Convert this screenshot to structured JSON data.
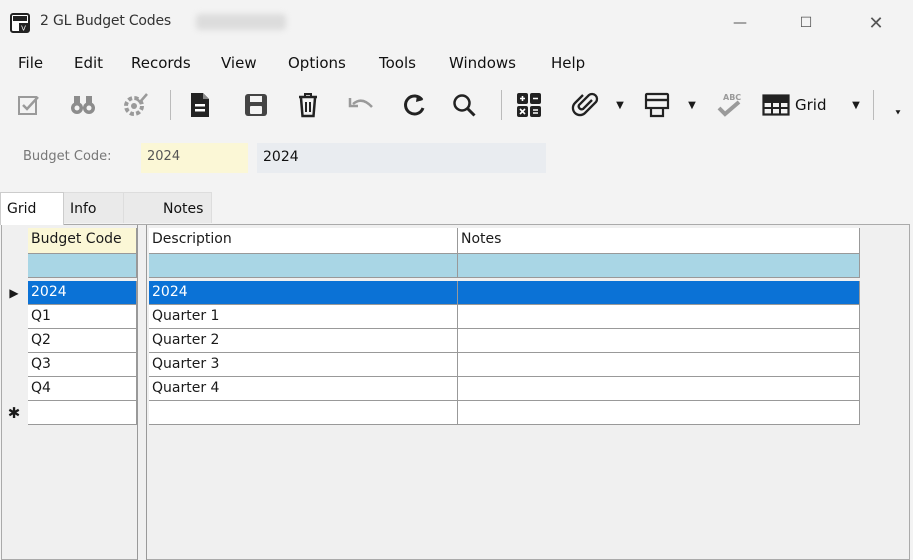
{
  "window": {
    "title": "2 GL Budget Codes",
    "controls": {
      "minimize": "—",
      "maximize": "☐",
      "close": "✕"
    }
  },
  "menu": [
    "File",
    "Edit",
    "Records",
    "View",
    "Options",
    "Tools",
    "Windows",
    "Help"
  ],
  "toolbar": {
    "grid_label": "Grid",
    "icons": [
      "checklist-icon",
      "binoculars-icon",
      "gear-check-icon",
      "document-icon",
      "save-icon",
      "trash-icon",
      "undo-icon",
      "refresh-icon",
      "search-icon",
      "calculator-icon",
      "attachment-icon",
      "print-icon",
      "spellcheck-icon",
      "grid-icon"
    ]
  },
  "form": {
    "budget_code_label": "Budget Code:",
    "budget_code_value": "2024",
    "description_value": "2024"
  },
  "tabs": [
    "Grid",
    "Info",
    "Notes"
  ],
  "grid": {
    "columns": [
      "Budget Code",
      "Description",
      "Notes"
    ],
    "rows": [
      {
        "code": "2024",
        "description": "2024",
        "notes": "",
        "selected": true
      },
      {
        "code": "Q1",
        "description": "Quarter 1",
        "notes": ""
      },
      {
        "code": "Q2",
        "description": "Quarter 2",
        "notes": ""
      },
      {
        "code": "Q3",
        "description": "Quarter 3",
        "notes": ""
      },
      {
        "code": "Q4",
        "description": "Quarter 4",
        "notes": ""
      }
    ],
    "current_row_marker": "▶",
    "new_row_marker": "✱"
  },
  "colors": {
    "selection": "#0b72d6",
    "filter_row": "#a9d6e5",
    "key_field": "#fbf7d6"
  }
}
